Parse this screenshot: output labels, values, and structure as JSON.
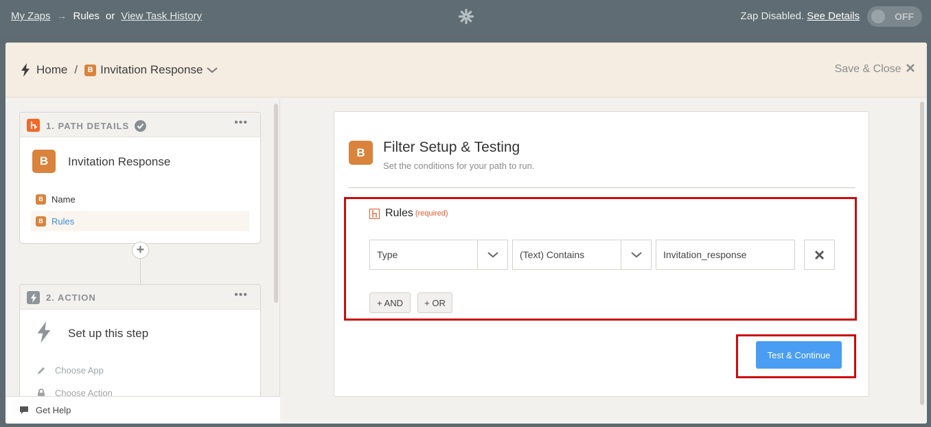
{
  "topbar": {
    "my_zaps": "My Zaps",
    "arrow": "→",
    "rules": "Rules",
    "or": "or",
    "task_history": "View Task History",
    "zap_status": "Zap Disabled.",
    "see_details": "See Details",
    "toggle_label": "OFF"
  },
  "header": {
    "home": "Home",
    "separator": "/",
    "path_badge": "B",
    "path_name": "Invitation Response",
    "save_close": "Save & Close"
  },
  "sidebar": {
    "step1": {
      "title": "1. PATH DETAILS",
      "dots": "•••",
      "badge": "B",
      "name": "Invitation Response",
      "items": [
        {
          "badge": "B",
          "label": "Name"
        },
        {
          "badge": "B",
          "label": "Rules"
        }
      ]
    },
    "plus": "+",
    "step2": {
      "title": "2. ACTION",
      "dots": "•••",
      "name": "Set up this step",
      "items": [
        {
          "label": "Choose App"
        },
        {
          "label": "Choose Action"
        }
      ]
    },
    "get_help": "Get Help"
  },
  "main": {
    "badge": "B",
    "title": "Filter Setup & Testing",
    "subtitle": "Set the conditions for your path to run.",
    "rules_label": "Rules",
    "required": "(required)",
    "field_value": "Type",
    "condition_value": "(Text) Contains",
    "match_value": "Invitation_response",
    "and_button": "+ AND",
    "or_button": "+ OR",
    "test_button": "Test & Continue"
  },
  "colors": {
    "accent_orange": "#d9833c",
    "primary_blue": "#499df3",
    "highlight_red": "#cc0a0a",
    "topbar": "#5f6c73"
  }
}
